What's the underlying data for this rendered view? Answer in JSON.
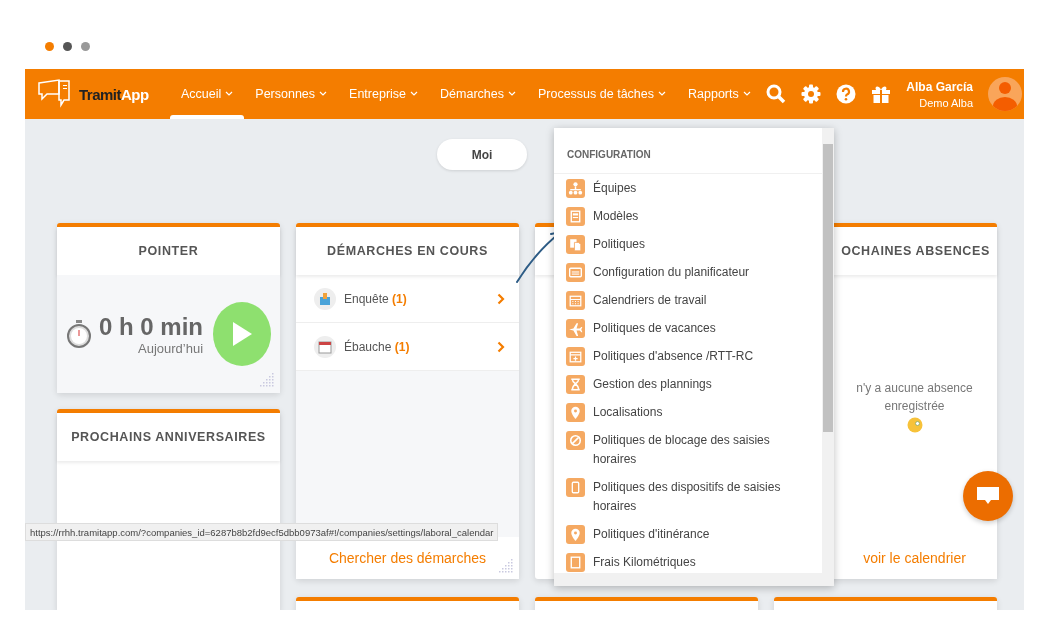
{
  "logo": {
    "dark": "Tramit",
    "light": "App"
  },
  "nav": [
    {
      "label": "Accueil",
      "selected": true
    },
    {
      "label": "Personnes",
      "selected": false
    },
    {
      "label": "Entreprise",
      "selected": false
    },
    {
      "label": "Démarches",
      "selected": false
    },
    {
      "label": "Processus de tâches",
      "selected": false
    },
    {
      "label": "Rapports",
      "selected": false
    }
  ],
  "user": {
    "name": "Alba García",
    "company": "Demo Alba"
  },
  "view_pill": "Moi",
  "punch_card": {
    "title": "POINTER",
    "time": "0 h 0 min",
    "day": "Aujourd’hui"
  },
  "birthdays_card": {
    "title": "PROCHAINS ANNIVERSAIRES"
  },
  "requests_card": {
    "title": "DÉMARCHES EN COURS",
    "rows": [
      {
        "label": "Enquête",
        "count": "(1)"
      },
      {
        "label": "Ébauche",
        "count": "(1)"
      }
    ],
    "footer": "Chercher des démarches"
  },
  "absences_card": {
    "title": "OCHAINES ABSENCES",
    "empty": "n'y a aucune absence enregistrée",
    "footer": "voir le calendrier"
  },
  "config_menu": {
    "heading": "CONFIGURATION",
    "items": [
      {
        "label": "Équipes"
      },
      {
        "label": "Modèles"
      },
      {
        "label": "Politiques"
      },
      {
        "label": "Configuration du planificateur"
      },
      {
        "label": "Calendriers de travail"
      },
      {
        "label": "Politiques de vacances"
      },
      {
        "label": "Politiques d'absence /RTT-RC"
      },
      {
        "label": "Gestion des plannings"
      },
      {
        "label": "Localisations"
      },
      {
        "label": "Politiques de blocage des saisies horaires"
      },
      {
        "label": "Politiques des dispositifs de saisies horaires"
      },
      {
        "label": "Politiques d'itinérance"
      },
      {
        "label": "Frais Kilométriques"
      }
    ]
  },
  "status_url": "https://rrhh.tramitapp.com/?companies_id=6287b8b2fd9ecf5dbb0973af#!/companies/settings/laboral_calendar"
}
